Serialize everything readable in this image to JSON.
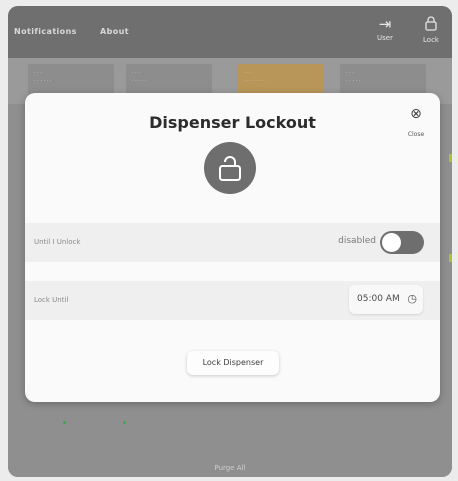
{
  "topbar": {
    "nav": [
      "Notifications",
      "About"
    ],
    "user_label": "User",
    "lock_label": "Lock",
    "user_icon": "user-login-icon",
    "lock_icon": "lock-icon"
  },
  "background": {
    "footer_label": "Purge All"
  },
  "modal": {
    "title": "Dispenser Lockout",
    "close_label": "Close",
    "close_icon": "close-circle-icon",
    "lock_icon": "unlocked-padlock-icon",
    "rows": {
      "until_unlock": {
        "label": "Until I Unlock",
        "status": "disabled"
      },
      "lock_until": {
        "label": "Lock Until",
        "time": "05:00 AM"
      }
    },
    "action_button": "Lock Dispenser"
  },
  "colors": {
    "modal_bg": "#fafafa",
    "row_bg": "#efefef",
    "toggle_off": "#6e6e6e",
    "active_tile": "#b8965a",
    "status_green": "#3da84a"
  }
}
